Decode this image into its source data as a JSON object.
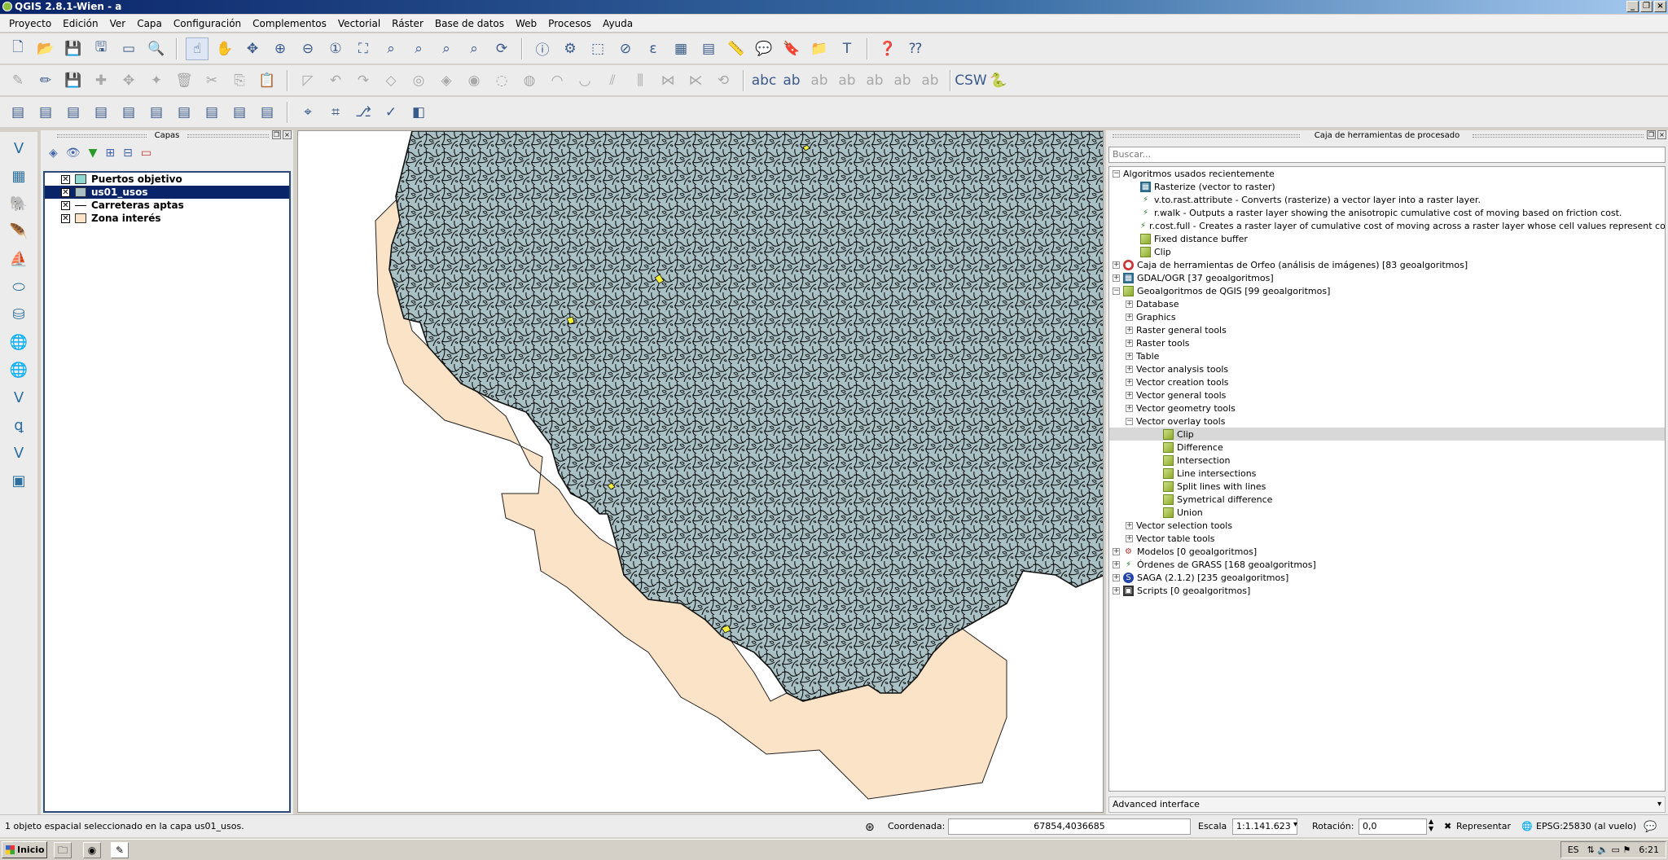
{
  "window": {
    "title": "QGIS 2.8.1-Wien - a"
  },
  "menu": [
    "Proyecto",
    "Edición",
    "Ver",
    "Capa",
    "Configuración",
    "Complementos",
    "Vectorial",
    "Ráster",
    "Base de datos",
    "Web",
    "Procesos",
    "Ayuda"
  ],
  "layers_panel": {
    "title": "Capas",
    "layers": [
      {
        "name": "Puertos objetivo",
        "checked": true,
        "symbol_color": "#8fd8cf",
        "selected": false
      },
      {
        "name": "us01_usos",
        "checked": true,
        "symbol_color": "#a9c1c4",
        "selected": true
      },
      {
        "name": "Carreteras aptas",
        "checked": true,
        "symbol_color": "#000000",
        "selected": false
      },
      {
        "name": "Zona interés",
        "checked": true,
        "symbol_color": "#fbe3c8",
        "selected": false
      }
    ]
  },
  "toolbox": {
    "title": "Caja de herramientas de procesado",
    "search_placeholder": "Buscar...",
    "advanced_label": "Advanced interface",
    "tree": [
      {
        "label": "Algoritmos usados recientemente",
        "level": 0,
        "expander": "minus",
        "icon": ""
      },
      {
        "label": "Rasterize (vector to raster)",
        "level": 2,
        "expander": "",
        "icon": "gdal"
      },
      {
        "label": "v.to.rast.attribute - Converts (rasterize) a vector layer into a raster layer.",
        "level": 2,
        "expander": "",
        "icon": "grass"
      },
      {
        "label": "r.walk - Outputs a raster layer showing the anisotropic cumulative cost of moving based on friction cost.",
        "level": 2,
        "expander": "",
        "icon": "grass"
      },
      {
        "label": "r.cost.full - Creates a raster layer of cumulative cost of moving across a raster layer whose cell values represent cost.",
        "level": 2,
        "expander": "",
        "icon": "grass"
      },
      {
        "label": "Fixed distance buffer",
        "level": 2,
        "expander": "",
        "icon": "alg"
      },
      {
        "label": "Clip",
        "level": 2,
        "expander": "",
        "icon": "alg"
      },
      {
        "label": "Caja de herramientas de Orfeo (análisis de imágenes) [83 geoalgoritmos]",
        "level": 0,
        "expander": "plus",
        "icon": "orfeo"
      },
      {
        "label": "GDAL/OGR [37 geoalgoritmos]",
        "level": 0,
        "expander": "plus",
        "icon": "gdal"
      },
      {
        "label": "Geoalgoritmos de QGIS [99 geoalgoritmos]",
        "level": 0,
        "expander": "minus",
        "icon": "alg"
      },
      {
        "label": "Database",
        "level": 1,
        "expander": "plus",
        "icon": ""
      },
      {
        "label": "Graphics",
        "level": 1,
        "expander": "plus",
        "icon": ""
      },
      {
        "label": "Raster general tools",
        "level": 1,
        "expander": "plus",
        "icon": ""
      },
      {
        "label": "Raster tools",
        "level": 1,
        "expander": "plus",
        "icon": ""
      },
      {
        "label": "Table",
        "level": 1,
        "expander": "plus",
        "icon": ""
      },
      {
        "label": "Vector analysis tools",
        "level": 1,
        "expander": "plus",
        "icon": ""
      },
      {
        "label": "Vector creation tools",
        "level": 1,
        "expander": "plus",
        "icon": ""
      },
      {
        "label": "Vector general tools",
        "level": 1,
        "expander": "plus",
        "icon": ""
      },
      {
        "label": "Vector geometry tools",
        "level": 1,
        "expander": "plus",
        "icon": ""
      },
      {
        "label": "Vector overlay tools",
        "level": 1,
        "expander": "minus",
        "icon": ""
      },
      {
        "label": "Clip",
        "level": 3,
        "expander": "",
        "icon": "alg",
        "selected": true
      },
      {
        "label": "Difference",
        "level": 3,
        "expander": "",
        "icon": "alg"
      },
      {
        "label": "Intersection",
        "level": 3,
        "expander": "",
        "icon": "alg"
      },
      {
        "label": "Line intersections",
        "level": 3,
        "expander": "",
        "icon": "alg"
      },
      {
        "label": "Split lines with lines",
        "level": 3,
        "expander": "",
        "icon": "alg"
      },
      {
        "label": "Symetrical difference",
        "level": 3,
        "expander": "",
        "icon": "alg"
      },
      {
        "label": "Union",
        "level": 3,
        "expander": "",
        "icon": "alg"
      },
      {
        "label": "Vector selection tools",
        "level": 1,
        "expander": "plus",
        "icon": ""
      },
      {
        "label": "Vector table tools",
        "level": 1,
        "expander": "plus",
        "icon": ""
      },
      {
        "label": "Modelos [0 geoalgoritmos]",
        "level": 0,
        "expander": "plus",
        "icon": "models"
      },
      {
        "label": "Órdenes de GRASS [168 geoalgoritmos]",
        "level": 0,
        "expander": "plus",
        "icon": "grass"
      },
      {
        "label": "SAGA (2.1.2) [235 geoalgoritmos]",
        "level": 0,
        "expander": "plus",
        "icon": "saga"
      },
      {
        "label": "Scripts [0 geoalgoritmos]",
        "level": 0,
        "expander": "plus",
        "icon": "script"
      }
    ]
  },
  "statusbar": {
    "message": "1 objeto espacial seleccionado en la capa us01_usos.",
    "coord_label": "Coordenada:",
    "coord_value": "67854,4036685",
    "scale_label": "Escala",
    "scale_value": "1:1.141.623",
    "rotation_label": "Rotación:",
    "rotation_value": "0,0",
    "render_label": "Representar",
    "crs": "EPSG:25830 (al vuelo)"
  },
  "taskbar": {
    "start": "Inicio",
    "lang": "ES",
    "clock": "6:21"
  },
  "colors": {
    "land_use": "#a9c1c4",
    "zone": "#fbe3c8",
    "highlight": "#f1ee3a"
  }
}
